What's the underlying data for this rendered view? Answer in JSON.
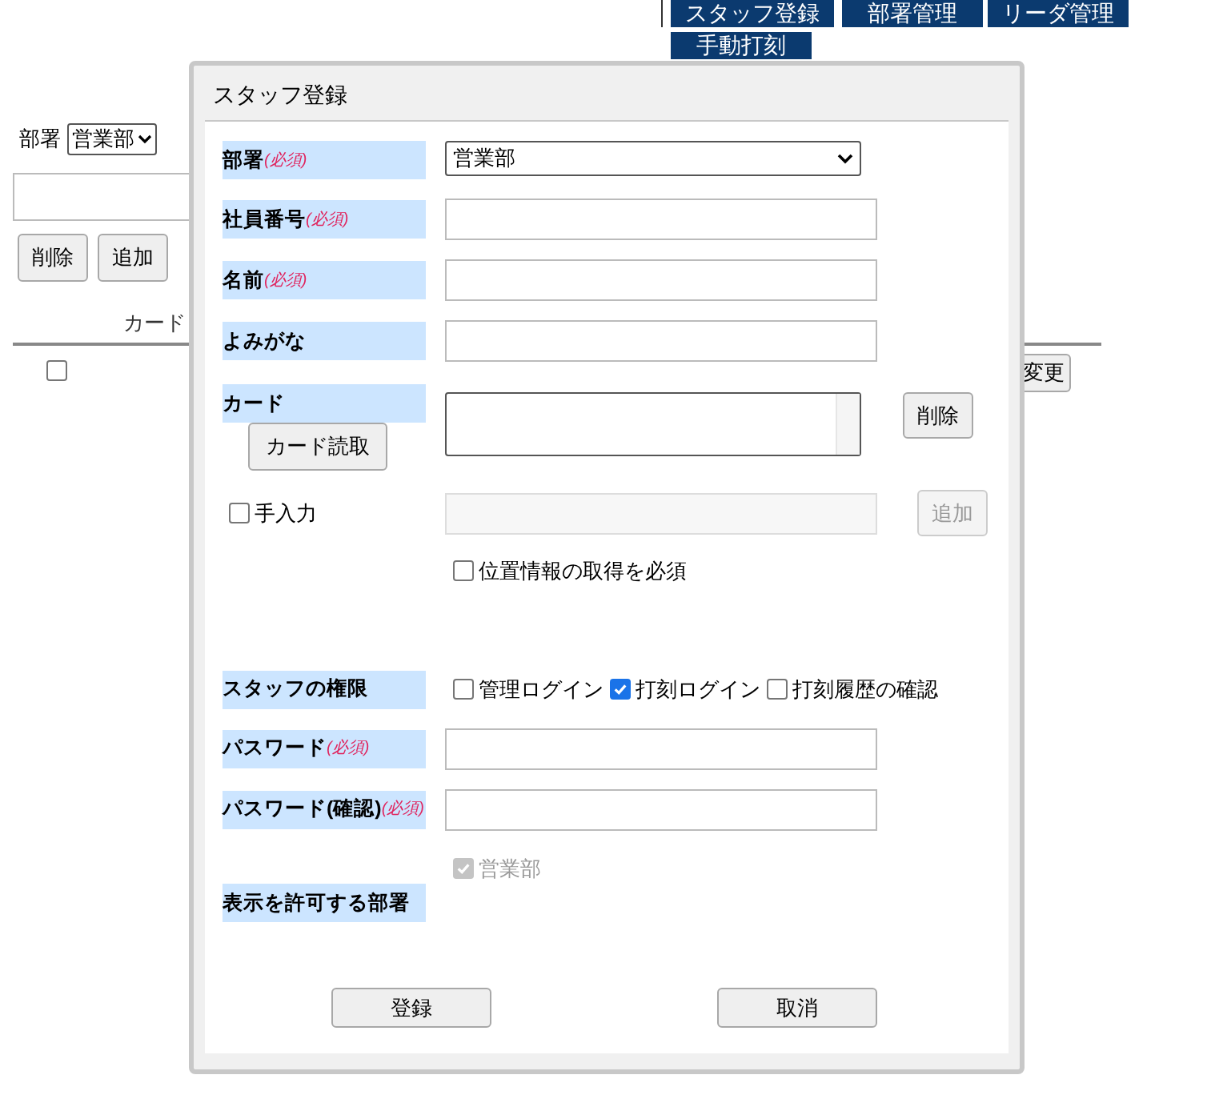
{
  "nav": [
    {
      "label": "スタッフ登録"
    },
    {
      "label": "部署管理"
    },
    {
      "label": "リーダ管理"
    },
    {
      "label": "手動打刻"
    }
  ],
  "page": {
    "department_filter": {
      "label": "部署",
      "value": "営業部"
    },
    "buttons": [
      "削除",
      "追加"
    ],
    "table": {
      "columns": [
        "カード"
      ],
      "rows": [
        {
          "checked": false,
          "action": "変更"
        }
      ]
    }
  },
  "dialog": {
    "title": "スタッフ登録",
    "rows": [
      {
        "kind": "select",
        "label": "部署",
        "required": "(必須)",
        "value": "営業部"
      },
      {
        "kind": "text",
        "label": "社員番号",
        "required": "(必須)"
      },
      {
        "kind": "text",
        "label": "名前",
        "required": "(必須)"
      },
      {
        "kind": "text",
        "label": "よみがな"
      },
      {
        "kind": "card",
        "label": "カード",
        "read_button": "カード読取",
        "delete_button": "削除"
      },
      {
        "kind": "manual",
        "checkbox": {
          "label": "手入力",
          "checked": false
        },
        "input_disabled": true,
        "add_button": {
          "label": "追加",
          "disabled": true
        }
      },
      {
        "kind": "option",
        "checkbox": {
          "label": "位置情報の取得を必須",
          "checked": false
        }
      },
      {
        "kind": "permissions",
        "label": "スタッフの権限",
        "options": [
          {
            "label": "管理ログイン",
            "checked": false
          },
          {
            "label": "打刻ログイン",
            "checked": true
          },
          {
            "label": "打刻履歴の確認",
            "checked": false
          }
        ]
      },
      {
        "kind": "text",
        "label": "パスワード",
        "required": "(必須)"
      },
      {
        "kind": "text",
        "label": "パスワード(確認)",
        "required": "(必須)"
      },
      {
        "kind": "departments",
        "label": "表示を許可する部署",
        "options": [
          {
            "label": "営業部",
            "checked": true,
            "disabled": true
          }
        ]
      }
    ],
    "buttons": [
      "登録",
      "取消"
    ]
  }
}
